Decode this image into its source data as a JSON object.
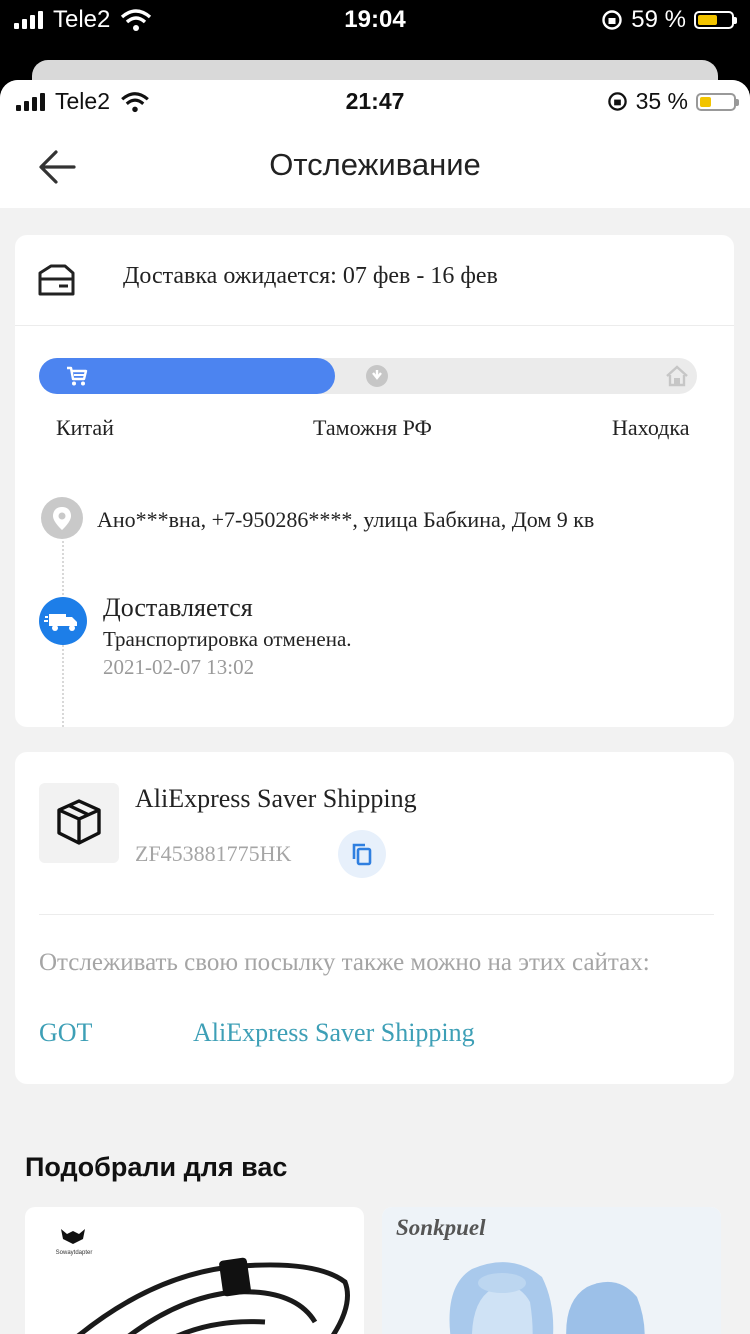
{
  "outer_status": {
    "carrier": "Tele2",
    "time": "19:04",
    "battery": "59 %",
    "battery_level": 0.59
  },
  "inner_status": {
    "carrier": "Tele2",
    "time": "21:47",
    "battery": "35 %",
    "battery_level": 0.35
  },
  "nav": {
    "title": "Отслеживание",
    "back_icon": "arrow-left-icon"
  },
  "delivery": {
    "estimate": "Доставка ожидается: 07 фев - 16 фев",
    "progress": 0.45,
    "stages": [
      "Китай",
      "Таможня РФ",
      "Находка"
    ],
    "address": "Ано***вна,  +7-950286****,  улица Бабкина, Дом 9 кв",
    "event": {
      "title": "Доставляется",
      "description": "Транспортировка отменена.",
      "time": "2021-02-07 13:02"
    }
  },
  "shipping": {
    "carrier": "AliExpress Saver Shipping",
    "tracking_number": "ZF453881775HK",
    "also_track_text": "Отслеживать свою посылку также можно на этих сайтах:",
    "links": [
      "GOT",
      "AliExpress Saver Shipping"
    ]
  },
  "recommendations": {
    "title": "Подобрали для вас",
    "items": [
      {
        "brand": "Sowaytdapter"
      },
      {
        "brand": "Sonkpuel"
      }
    ]
  },
  "colors": {
    "accent": "#4c84f0",
    "truck": "#1d7ee8",
    "link": "#3d9fb6",
    "muted": "#a5a5a5"
  }
}
